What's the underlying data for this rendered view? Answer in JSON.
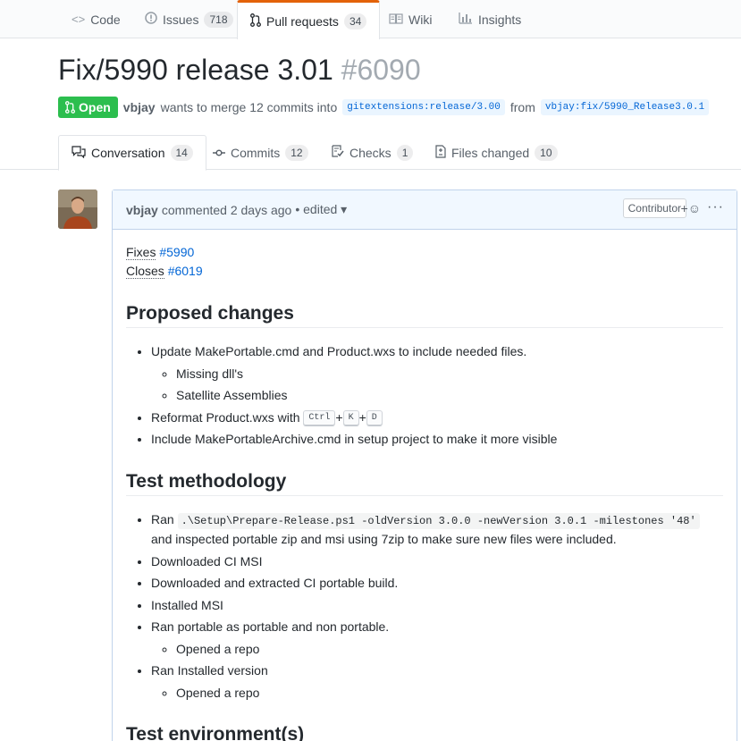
{
  "repo_nav": {
    "tabs": [
      {
        "label": "Code",
        "icon": "code-icon"
      },
      {
        "label": "Issues",
        "count": "718",
        "icon": "issue-icon"
      },
      {
        "label": "Pull requests",
        "count": "34",
        "icon": "pull-request-icon"
      },
      {
        "label": "Wiki",
        "icon": "book-icon"
      },
      {
        "label": "Insights",
        "icon": "graph-icon"
      }
    ]
  },
  "pr": {
    "title": "Fix/5990 release 3.01",
    "number": "#6090",
    "state": "Open",
    "author": "vbjay",
    "merge_text": "wants to merge 12 commits into",
    "base_branch": "gitextensions:release/3.00",
    "from_text": "from",
    "head_branch": "vbjay:fix/5990_Release3.0.1"
  },
  "pr_tabs": [
    {
      "label": "Conversation",
      "count": "14",
      "icon": "comment-discussion-icon"
    },
    {
      "label": "Commits",
      "count": "12",
      "icon": "git-commit-icon"
    },
    {
      "label": "Checks",
      "count": "1",
      "icon": "checklist-icon"
    },
    {
      "label": "Files changed",
      "count": "10",
      "icon": "file-diff-icon"
    }
  ],
  "comment": {
    "author": "vbjay",
    "action": "commented 2 days ago",
    "edited": "• edited ▾",
    "badge": "Contributor",
    "reaction": "+☺",
    "more": "···",
    "refs": [
      {
        "prefix": "Fixes",
        "link": "#5990"
      },
      {
        "prefix": "Closes",
        "link": "#6019"
      }
    ],
    "sections": {
      "proposed_title": "Proposed changes",
      "proposed": {
        "item1": "Update MakePortable.cmd and Product.wxs to include needed files.",
        "item1_sub1": "Missing dll's",
        "item1_sub2": "Satellite Assemblies",
        "item2_text": "Reformat Product.wxs with",
        "item2_keys": [
          "Ctrl",
          "K",
          "D"
        ],
        "item2_plus": "+",
        "item3": "Include MakePortableArchive.cmd in setup project to make it more visible"
      },
      "test_title": "Test methodology",
      "test": {
        "item1_prefix": "Ran",
        "item1_code": ".\\Setup\\Prepare-Release.ps1 -oldVersion 3.0.0 -newVersion 3.0.1 -milestones '48'",
        "item1_suffix": "and",
        "item1_line2": "inspected portable zip and msi using 7zip to make sure new files were included.",
        "item2": "Downloaded CI MSI",
        "item3": "Downloaded and extracted CI portable build.",
        "item4": "Installed MSI",
        "item5": "Ran portable as portable and non portable.",
        "item5_sub": "Opened a repo",
        "item6": "Ran Installed version",
        "item6_sub": "Opened a repo"
      },
      "env_title": "Test environment(s)"
    }
  }
}
